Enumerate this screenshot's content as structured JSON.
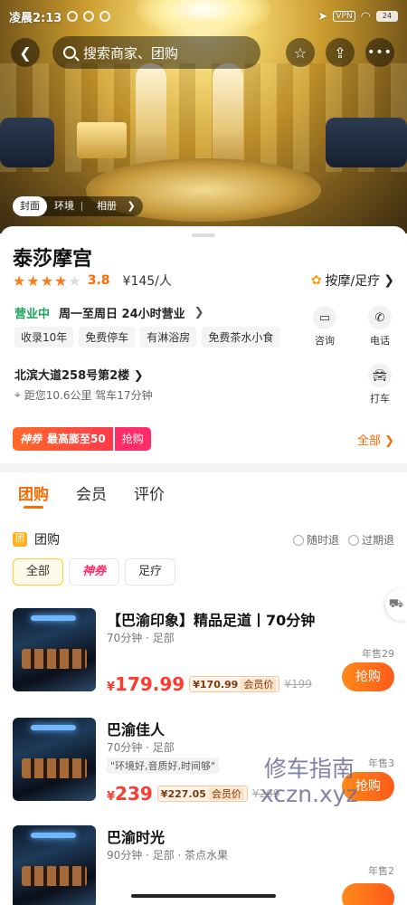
{
  "status": {
    "time": "凌晨2:13",
    "vpn": "VPN",
    "battery": "24"
  },
  "search": {
    "placeholder": "搜索商家、团购"
  },
  "photo_tabs": [
    "封面",
    "环境",
    "相册"
  ],
  "shop": {
    "name": "泰莎摩宫",
    "stars_filled": 4,
    "stars_total": 5,
    "score": "3.8",
    "price": "¥145/人",
    "category": "按摩/足疗",
    "open_status": "营业中",
    "hours": "周一至周日 24小时营业",
    "tags": [
      "收录10年",
      "免费停车",
      "有淋浴房",
      "免费茶水小食"
    ],
    "address": "北滨大道258号第2楼",
    "distance": "距您10.6公里 驾车17分钟",
    "actions": {
      "consult": "咨询",
      "call": "电话",
      "taxi": "打车"
    },
    "promo_label": "神券",
    "promo_text": "最高膨至50",
    "promo_grab": "抢购",
    "all_link": "全部"
  },
  "tabs": [
    "团购",
    "会员",
    "评价"
  ],
  "deals_section": {
    "badge": "团",
    "title": "团购",
    "policies": [
      "随时退",
      "过期退"
    ],
    "filters": [
      "全部",
      "神券",
      "足疗"
    ]
  },
  "deals": [
    {
      "title": "【巴渝印象】精品足道丨70分钟",
      "meta": "70分钟 · 足部",
      "quote": "",
      "price_prefix": "¥",
      "price_now": "179.99",
      "price_member": "¥170.99",
      "member_label": "会员价",
      "price_old": "¥199",
      "sold": "年售29",
      "buy": "抢购"
    },
    {
      "title": "巴渝佳人",
      "meta": "70分钟 · 足部",
      "quote": "\"环境好,音质好,时间够\"",
      "price_prefix": "¥",
      "price_now": "239",
      "price_member": "¥227.05",
      "member_label": "会员价",
      "price_old": "¥269",
      "sold": "年售3",
      "buy": "抢购"
    },
    {
      "title": "巴渝时光",
      "meta": "90分钟 · 足部 · 茶点水果",
      "quote": "",
      "price_prefix": "",
      "price_now": "",
      "price_member": "",
      "member_label": "",
      "price_old": "",
      "sold": "年售2",
      "buy": ""
    }
  ],
  "watermark": {
    "line1": "修车指南",
    "line2": "xczn.xyz"
  },
  "colors": {
    "accent": "#ff6a00",
    "price": "#ff3b30",
    "open": "#1aa35a"
  }
}
